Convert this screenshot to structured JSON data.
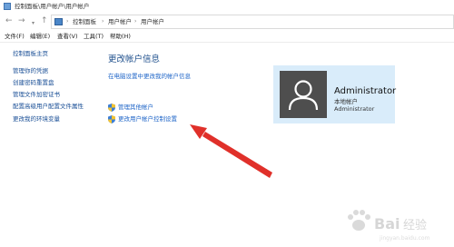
{
  "window": {
    "title": "控制面板\\用户帐户\\用户帐户"
  },
  "nav": {
    "back_icon": "back-arrow-icon",
    "forward_icon": "forward-arrow-icon",
    "recent_icon": "chevron-down-icon",
    "up_icon": "up-arrow-icon",
    "breadcrumbs": [
      "控制面板",
      "用户帐户",
      "用户帐户"
    ]
  },
  "menu": [
    "文件(F)",
    "编辑(E)",
    "查看(V)",
    "工具(T)",
    "帮助(H)"
  ],
  "sidebar": {
    "items": [
      "控制面板主页",
      "管理你的凭据",
      "创建密码重置盘",
      "管理文件加密证书",
      "配置高级用户配置文件属性",
      "更改我的环境变量"
    ]
  },
  "main": {
    "heading": "更改帐户信息",
    "change_in_settings": "在电脑设置中更改我的帐户信息",
    "manage_other": "管理其他帐户",
    "change_uac": "更改用户帐户控制设置"
  },
  "user": {
    "name": "Administrator",
    "account_type": "本地帐户",
    "group": "Administrator"
  },
  "colors": {
    "link": "#2066c8",
    "heading": "#1e4f8c",
    "card": "#d9ecfa",
    "annotation_arrow": "#e0302a"
  }
}
